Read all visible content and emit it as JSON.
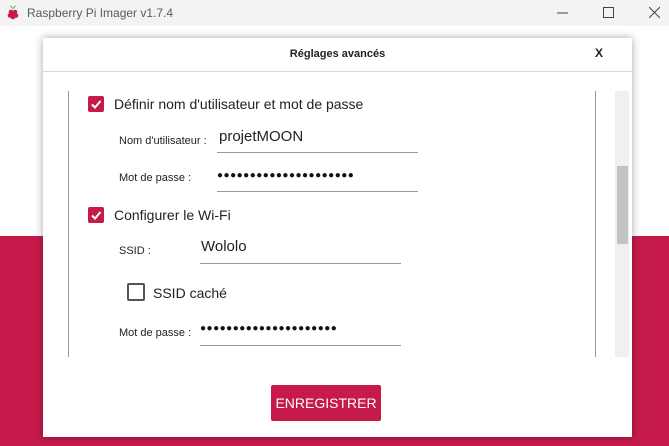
{
  "window": {
    "title": "Raspberry Pi Imager v1.7.4",
    "icon": "raspberry-icon",
    "controls": [
      "minimize-icon",
      "maximize-icon",
      "close-icon"
    ],
    "brand_color": "#c51a4a"
  },
  "dialog": {
    "title": "Réglages avancés",
    "close_label": "X",
    "user_section": {
      "checkbox_label": "Définir nom d'utilisateur et mot de passe",
      "checked": true,
      "username_label": "Nom d'utilisateur :",
      "username_value": "projetMOON",
      "password_label": "Mot de passe :",
      "password_value": "●●●●●●●●●●●●●●●●●●●●●"
    },
    "wifi_section": {
      "checkbox_label": "Configurer le Wi-Fi",
      "checked": true,
      "ssid_label": "SSID :",
      "ssid_value": "Wololo",
      "hidden_ssid_label": "SSID caché",
      "hidden_ssid_checked": false,
      "password_label": "Mot de passe :",
      "password_value": "●●●●●●●●●●●●●●●●●●●●●"
    },
    "save_button": "ENREGISTRER"
  }
}
